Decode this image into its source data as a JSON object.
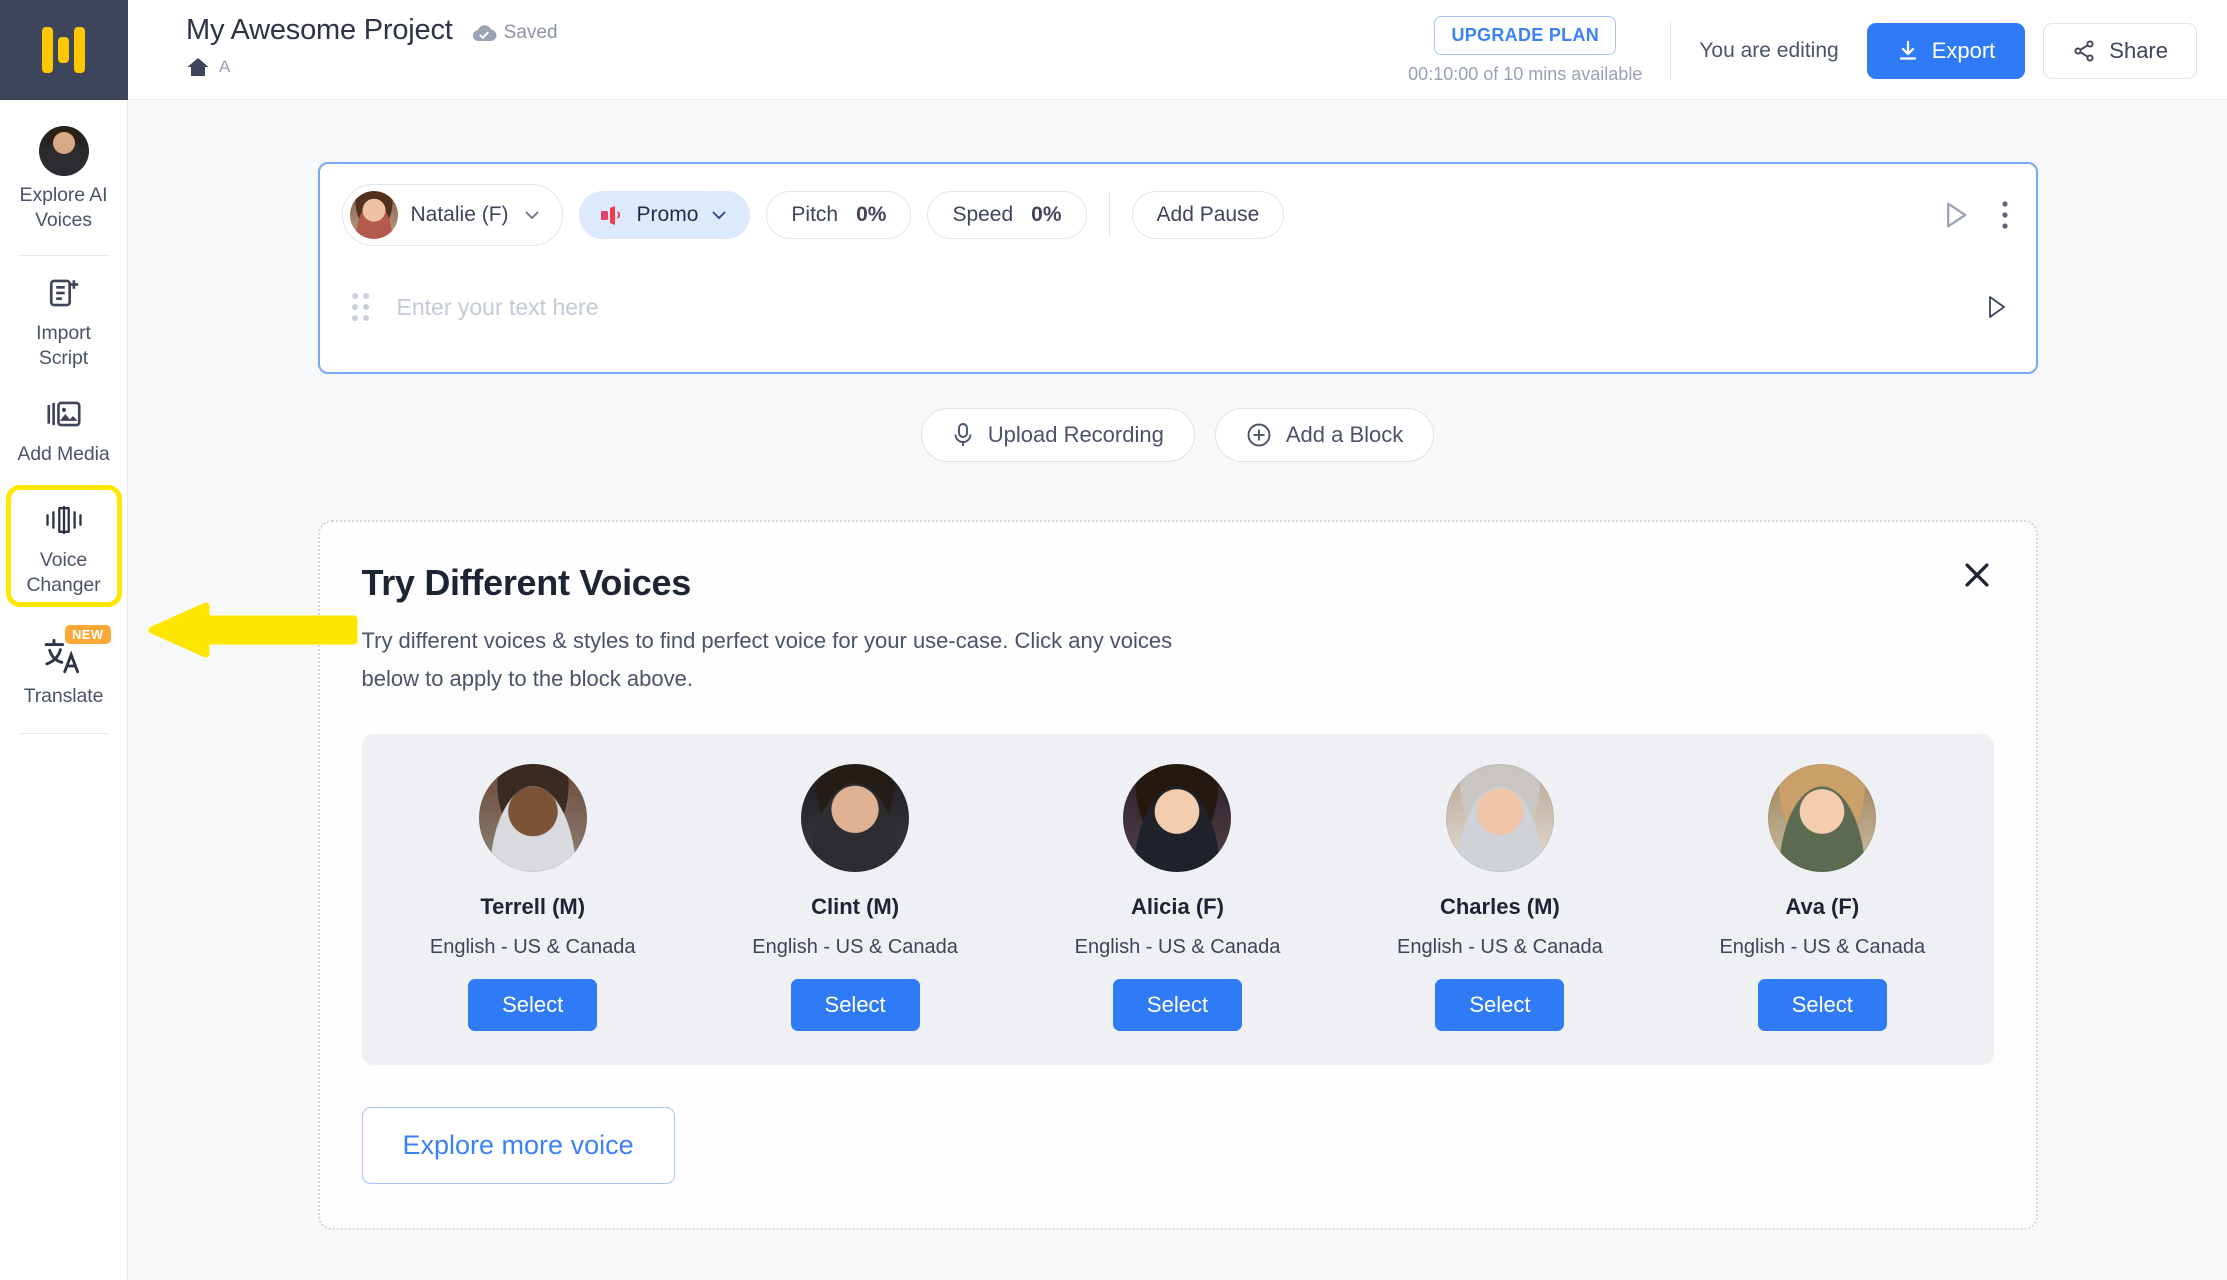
{
  "brand": {
    "logo_name": "murf-logo",
    "accent": "#FCC800",
    "primary": "#2f7bf6"
  },
  "sidebar": {
    "items": [
      {
        "label": "Explore AI\nVoices",
        "label_l1": "Explore AI",
        "label_l2": "Voices",
        "icon": "avatar-icon"
      },
      {
        "label_l1": "Import",
        "label_l2": "Script",
        "icon": "import-script-icon"
      },
      {
        "label_l1": "Add Media",
        "label_l2": "",
        "icon": "add-media-icon"
      },
      {
        "label_l1": "Voice",
        "label_l2": "Changer",
        "icon": "voice-changer-icon",
        "highlighted": true
      },
      {
        "label_l1": "Translate",
        "label_l2": "",
        "icon": "translate-icon",
        "badge": "NEW"
      }
    ]
  },
  "header": {
    "project_title": "My Awesome Project",
    "saved_label": "Saved",
    "breadcrumb_home": "home-icon",
    "breadcrumb_text": "A",
    "upgrade_label": "UPGRADE PLAN",
    "plan_time": "00:10:00 of 10 mins available",
    "editing_status": "You are editing",
    "export_label": "Export",
    "share_label": "Share"
  },
  "block": {
    "voice_name": "Natalie (F)",
    "style_name": "Promo",
    "pitch_label": "Pitch",
    "pitch_value": "0%",
    "speed_label": "Speed",
    "speed_value": "0%",
    "add_pause_label": "Add Pause",
    "text_placeholder": "Enter your text here"
  },
  "actions": {
    "upload_recording": "Upload Recording",
    "add_block": "Add a Block"
  },
  "voices_panel": {
    "title": "Try Different Voices",
    "description": "Try different voices & styles to find perfect voice for your use-case. Click any voices below to apply to the block above.",
    "select_label": "Select",
    "explore_label": "Explore more voice",
    "voices": [
      {
        "name": "Terrell (M)",
        "language": "English - US & Canada"
      },
      {
        "name": "Clint (M)",
        "language": "English - US & Canada"
      },
      {
        "name": "Alicia (F)",
        "language": "English - US & Canada"
      },
      {
        "name": "Charles (M)",
        "language": "English - US & Canada"
      },
      {
        "name": "Ava (F)",
        "language": "English - US & Canada"
      }
    ]
  },
  "annotation": {
    "arrow_color": "#FFE600",
    "points_to": "Voice Changer"
  }
}
